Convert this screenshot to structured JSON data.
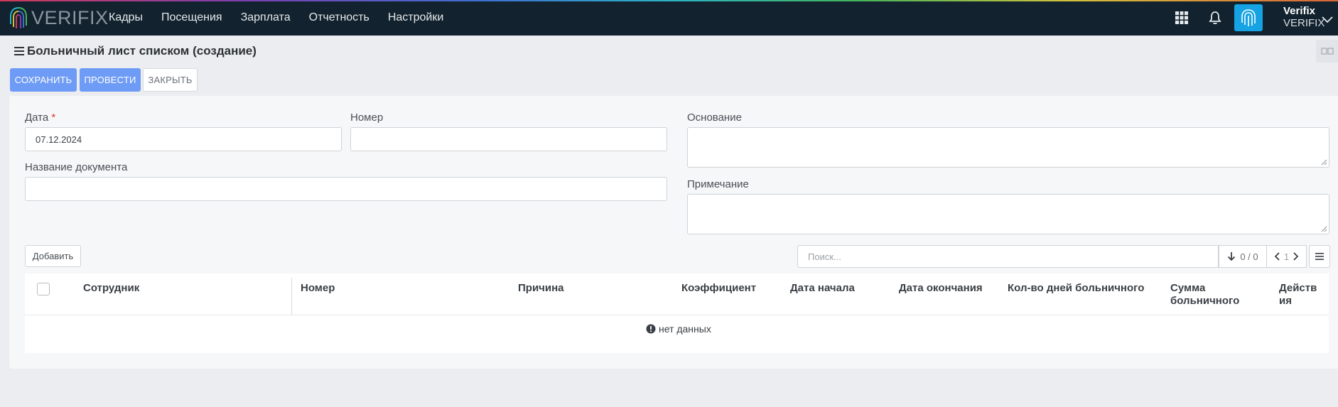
{
  "app": {
    "logo_text": "VERIFIX"
  },
  "nav": {
    "items": [
      "Кадры",
      "Посещения",
      "Зарплата",
      "Отчетность",
      "Настройки"
    ]
  },
  "user": {
    "name": "Verifix",
    "org": "VERIFIX"
  },
  "page": {
    "title": "Больничный лист списком (создание)"
  },
  "actions": {
    "save": "СОХРАНИТЬ",
    "post": "ПРОВЕСТИ",
    "close": "ЗАКРЫТЬ"
  },
  "form": {
    "date_label": "Дата",
    "date_required_mark": "*",
    "date_value": "07.12.2024",
    "number_label": "Номер",
    "number_value": "",
    "doc_name_label": "Название документа",
    "doc_name_value": "",
    "basis_label": "Основание",
    "note_label": "Примечание"
  },
  "table_toolbar": {
    "add_button": "Добавить",
    "search_placeholder": "Поиск...",
    "count": "0 / 0",
    "page": "1"
  },
  "table": {
    "columns": [
      "Сотрудник",
      "Номер",
      "Причина",
      "Коэффициент",
      "Дата начала",
      "Дата окончания",
      "Кол-во дней больничного",
      "Сумма больничного",
      "Действия"
    ],
    "empty_text": "нет данных"
  },
  "colors": {
    "accent": "#6e9bf5",
    "navbar": "#12222e",
    "fingerprint": "#15a3e3"
  },
  "icons": [
    "fingerprint-logo-icon",
    "apps-grid-icon",
    "bell-icon",
    "fingerprint-icon",
    "chevron-down-icon",
    "menu-icon",
    "sort-down-icon",
    "chevron-left-icon",
    "chevron-right-icon",
    "columns-menu-icon",
    "info-icon"
  ]
}
